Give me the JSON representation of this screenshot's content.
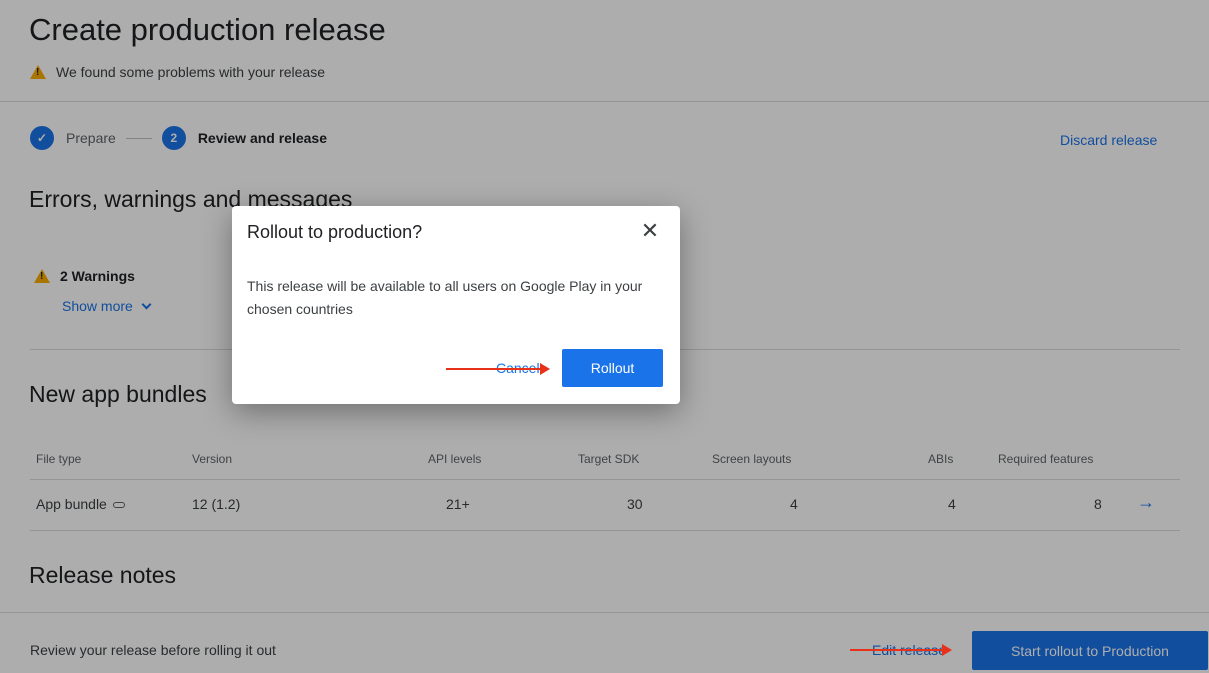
{
  "page": {
    "title": "Create production release",
    "problems_message": "We found some problems with your release"
  },
  "stepper": {
    "step1": {
      "number": "✓",
      "label": "Prepare"
    },
    "step2": {
      "number": "2",
      "label": "Review and release"
    },
    "discard_label": "Discard release"
  },
  "errors_section": {
    "heading": "Errors, warnings and messages",
    "warnings_label": "2 Warnings",
    "show_more_label": "Show more"
  },
  "bundles_section": {
    "heading": "New app bundles",
    "columns": [
      "File type",
      "Version",
      "API levels",
      "Target SDK",
      "Screen layouts",
      "ABIs",
      "Required features"
    ],
    "rows": [
      {
        "file_type": "App bundle",
        "version": "12 (1.2)",
        "api_levels": "21+",
        "target_sdk": "30",
        "screen_layouts": "4",
        "abis": "4",
        "required_features": "8"
      }
    ]
  },
  "release_notes": {
    "heading": "Release notes"
  },
  "footer": {
    "message": "Review your release before rolling it out",
    "edit_label": "Edit release",
    "start_label": "Start rollout to Production"
  },
  "dialog": {
    "title": "Rollout to production?",
    "body": "This release will be available to all users on Google Play in your chosen countries",
    "cancel_label": "Cancel",
    "confirm_label": "Rollout"
  },
  "colors": {
    "accent": "#1a73e8",
    "warning": "#f9ab00",
    "annotation": "#e8311a"
  }
}
